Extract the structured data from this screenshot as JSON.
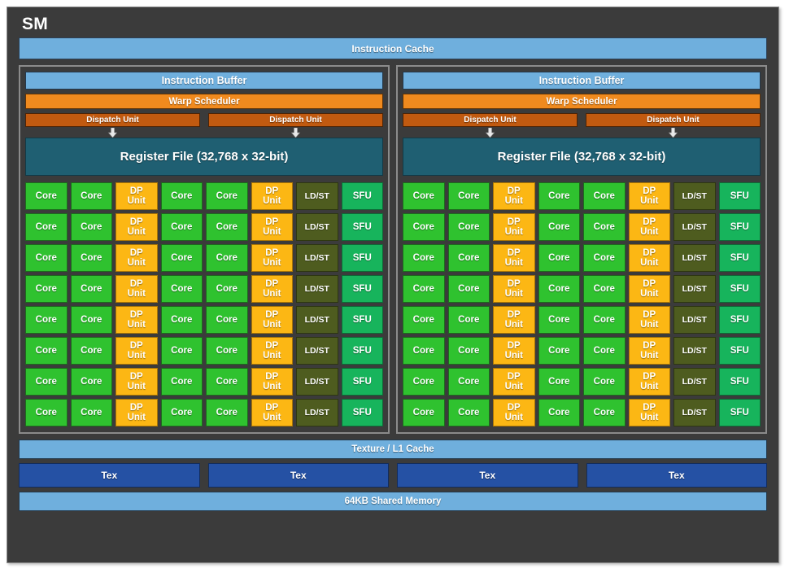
{
  "diagram": {
    "title": "SM",
    "instruction_cache": "Instruction Cache",
    "texture_l1_cache": "Texture / L1 Cache",
    "shared_memory": "64KB Shared Memory",
    "tex_units": [
      "Tex",
      "Tex",
      "Tex",
      "Tex"
    ],
    "partitions": [
      {
        "instruction_buffer": "Instruction Buffer",
        "warp_scheduler": "Warp Scheduler",
        "dispatch_units": [
          "Dispatch Unit",
          "Dispatch Unit"
        ],
        "register_file": "Register File (32,768 x 32-bit)",
        "row_labels": [
          "Core",
          "Core",
          "DP Unit",
          "Core",
          "Core",
          "DP Unit",
          "LD/ST",
          "SFU"
        ],
        "rows": 8
      },
      {
        "instruction_buffer": "Instruction Buffer",
        "warp_scheduler": "Warp Scheduler",
        "dispatch_units": [
          "Dispatch Unit",
          "Dispatch Unit"
        ],
        "register_file": "Register File (32,768 x 32-bit)",
        "row_labels": [
          "Core",
          "Core",
          "DP Unit",
          "Core",
          "Core",
          "DP Unit",
          "LD/ST",
          "SFU"
        ],
        "rows": 8
      }
    ],
    "unit_text": {
      "core": "Core",
      "dp_line1": "DP",
      "dp_line2": "Unit",
      "ldst": "LD/ST",
      "sfu": "SFU"
    },
    "colors": {
      "background": "#3b3b3b",
      "cache_blue": "#6fafdd",
      "warp_scheduler_orange": "#f08a1e",
      "dispatch_orange": "#c15a10",
      "register_file_teal": "#1f5f72",
      "core_green": "#2fc22f",
      "dp_amber": "#fcb714",
      "ldst_olive": "#4e5c1f",
      "sfu_green": "#17b45c",
      "tex_blue": "#2551a4"
    }
  }
}
